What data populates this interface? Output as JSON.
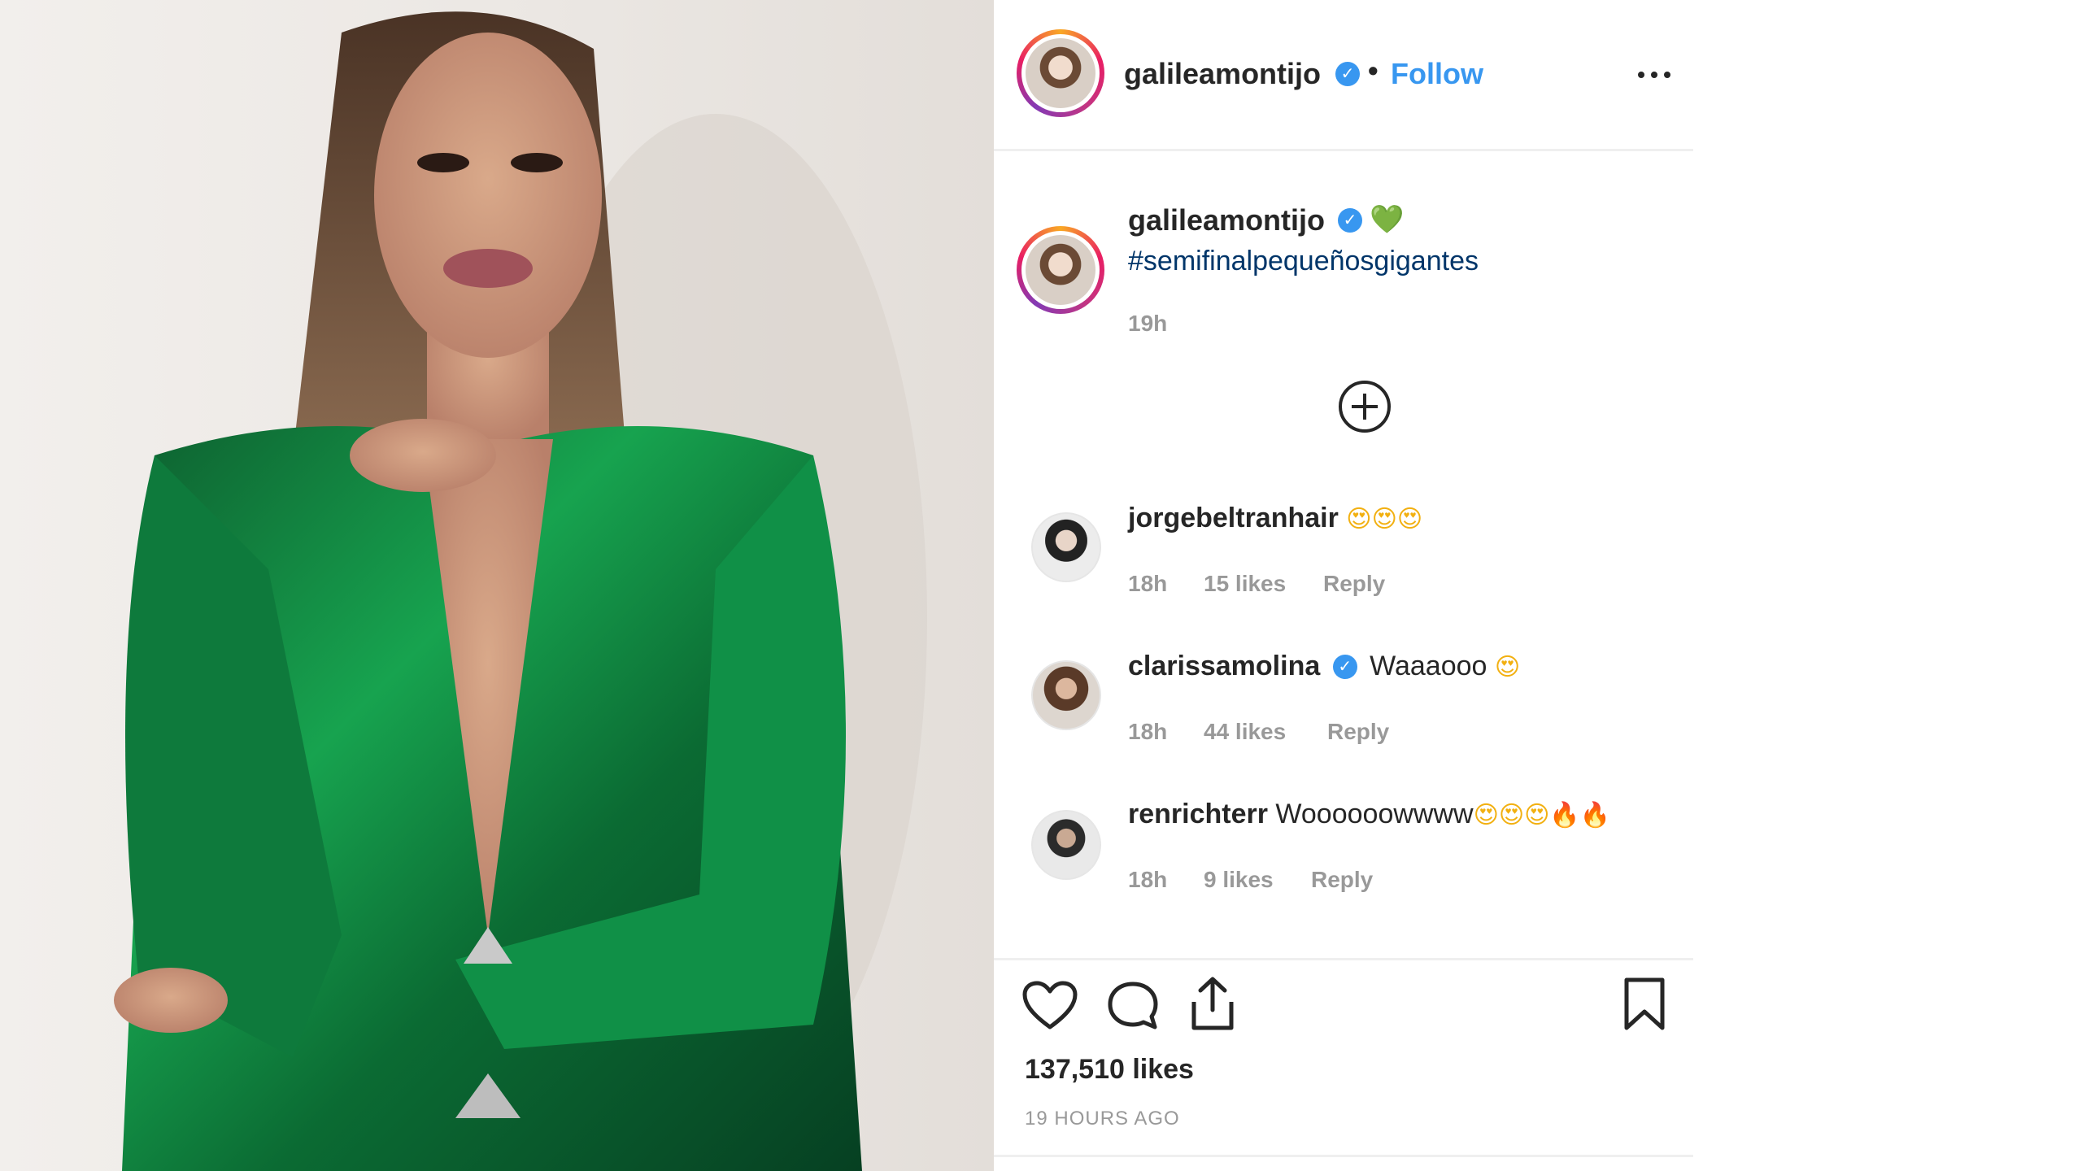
{
  "colors": {
    "accent_link": "#3897f0",
    "hashtag": "#003569",
    "muted": "#999999",
    "text": "#262626",
    "dress_green": "#0f7a3c"
  },
  "photo": {
    "subject": "woman in green satin dress"
  },
  "header": {
    "username": "galileamontijo",
    "verified_icon": "verified-badge-icon",
    "separator": "•",
    "follow_label": "Follow",
    "more_icon": "more-options-icon"
  },
  "caption": {
    "username": "galileamontijo",
    "emoji": "💚",
    "hashtag": "#semifinalpequeñosgigantes",
    "time": "19h"
  },
  "load_more_icon": "plus-circle-icon",
  "comments": [
    {
      "username": "jorgebeltranhair",
      "verified": false,
      "text": "",
      "emojis": "😍😍😍",
      "time": "18h",
      "likes": "15 likes",
      "reply": "Reply"
    },
    {
      "username": "clarissamolina",
      "verified": true,
      "text": "Waaaooo",
      "emojis": "😍",
      "time": "18h",
      "likes": "44 likes",
      "reply": "Reply"
    },
    {
      "username": "renrichterr",
      "verified": false,
      "text": "Woooooowwww",
      "emojis": "😍😍😍",
      "fire": "🔥🔥",
      "time": "18h",
      "likes": "9 likes",
      "reply": "Reply"
    }
  ],
  "actions": {
    "like_icon": "heart-icon",
    "comment_icon": "comment-icon",
    "share_icon": "share-icon",
    "save_icon": "bookmark-icon"
  },
  "likes_count": "137,510 likes",
  "time_ago": "19 HOURS AGO"
}
